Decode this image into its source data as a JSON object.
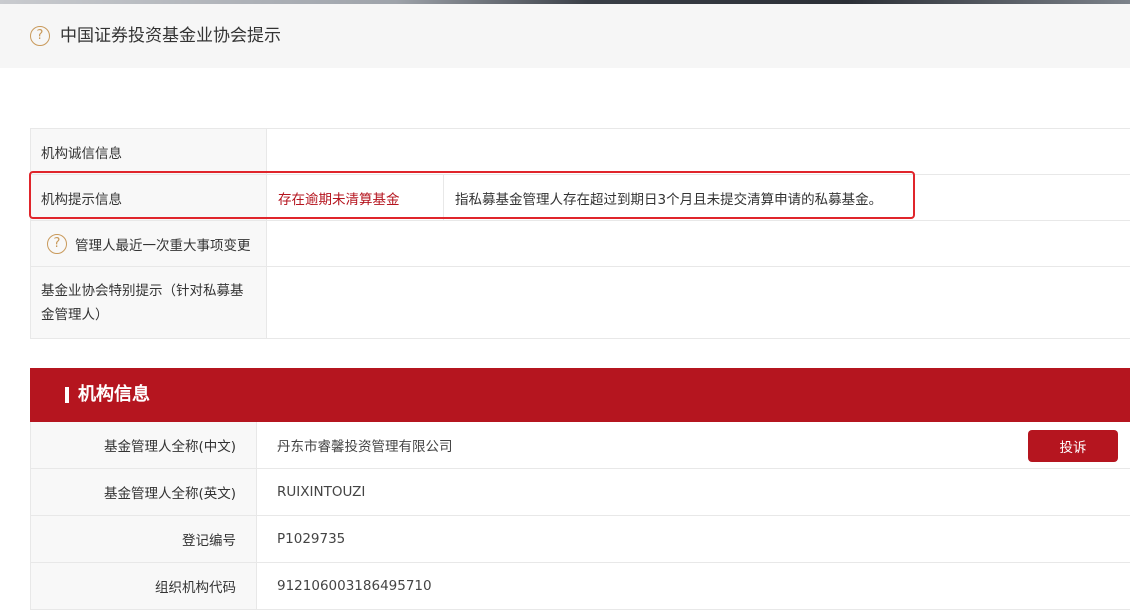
{
  "notice": {
    "title": "中国证券投资基金业协会提示",
    "help_glyph": "?"
  },
  "credit_info": {
    "rows": [
      {
        "label": "机构诚信信息"
      },
      {
        "label": "机构提示信息",
        "tag": "存在逾期未清算基金",
        "description": "指私募基金管理人存在超过到期日3个月且未提交清算申请的私募基金。"
      },
      {
        "label": "管理人最近一次重大事项变更"
      },
      {
        "label": "基金业协会特别提示（针对私募基金管理人）"
      }
    ]
  },
  "org_section": {
    "title": "机构信息",
    "rows": [
      {
        "label": "基金管理人全称(中文)",
        "value": "丹东市睿馨投资管理有限公司"
      },
      {
        "label": "基金管理人全称(英文)",
        "value": "RUIXINTOUZI"
      },
      {
        "label": "登记编号",
        "value": "P1029735"
      },
      {
        "label": "组织机构代码",
        "value": "912106003186495710"
      }
    ],
    "complain_button": "投诉"
  },
  "colors": {
    "accent_red": "#b5151f",
    "highlight_red": "#e0252b",
    "help_icon": "#c99a5b"
  },
  "icons": [
    "help-circle-icon"
  ]
}
